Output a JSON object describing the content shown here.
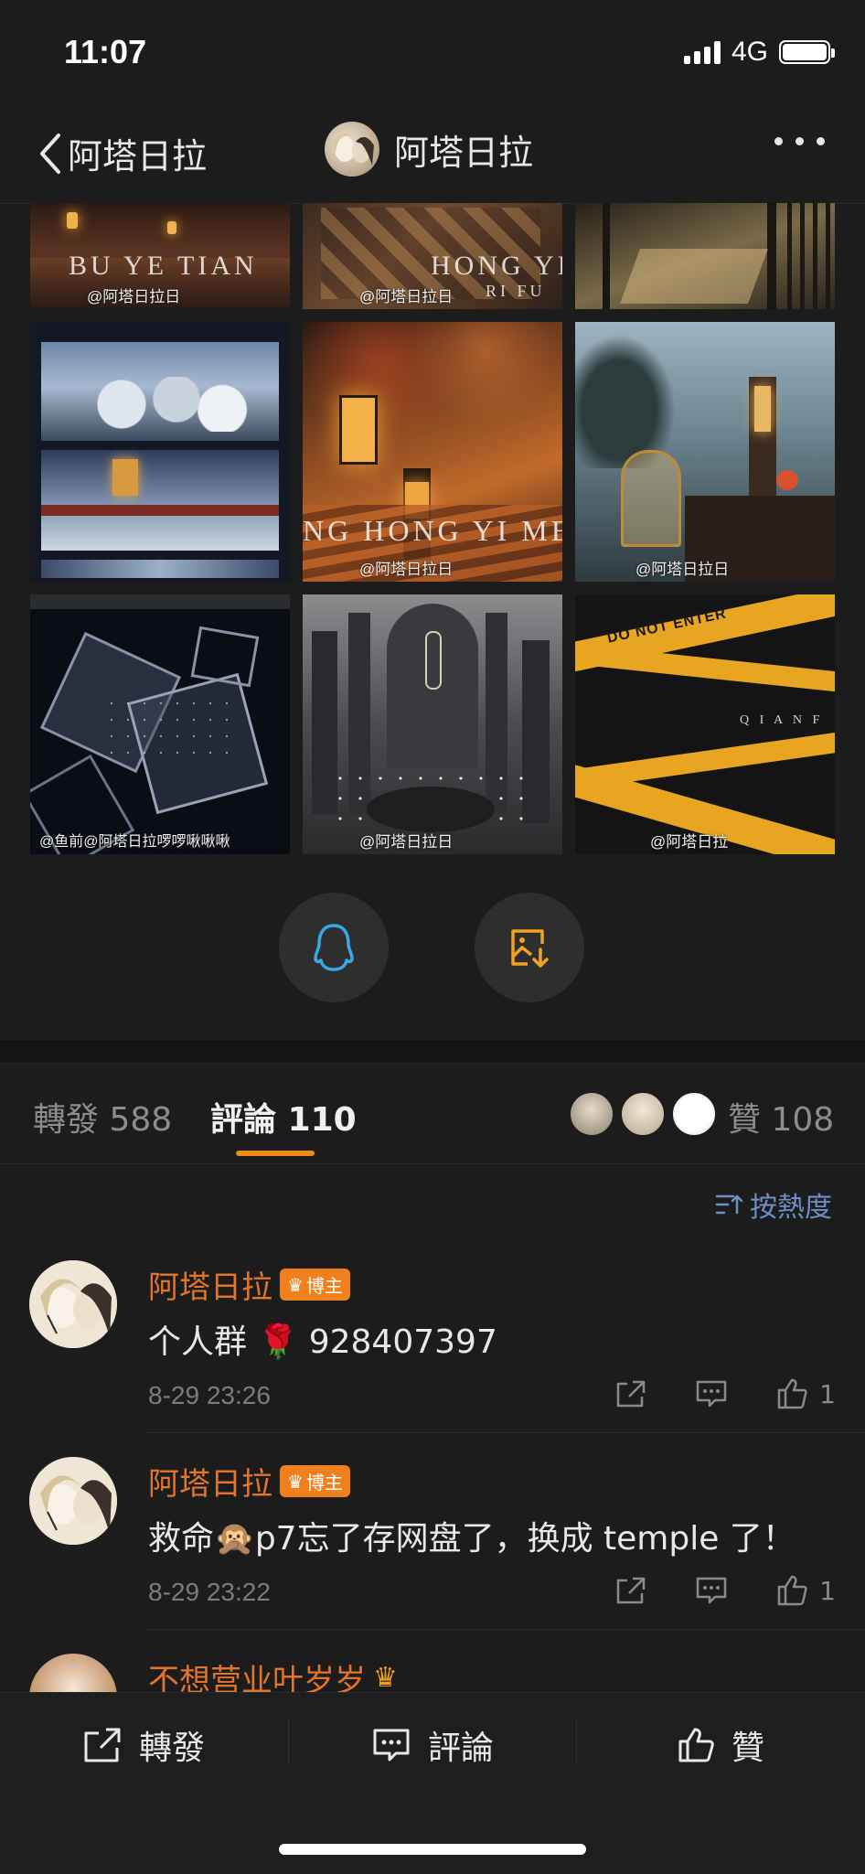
{
  "status_bar": {
    "time": "11:07",
    "network": "4G"
  },
  "nav": {
    "back_label": "阿塔日拉",
    "title": "阿塔日拉"
  },
  "gallery": {
    "images": [
      {
        "overlay_text": "BU YE TIAN",
        "watermark": "@阿塔日拉日"
      },
      {
        "overlay_text": "HONG YE",
        "overlay_text2": "RI FU",
        "watermark": "@阿塔日拉日"
      },
      {
        "overlay_text": "",
        "watermark": ""
      },
      {
        "overlay_text": "",
        "watermark": ""
      },
      {
        "overlay_text": "NG HONG YI MEN",
        "watermark": "@阿塔日拉日"
      },
      {
        "overlay_text": "",
        "watermark": "@阿塔日拉日"
      },
      {
        "overlay_text": "",
        "watermark": "@鱼前@阿塔日拉啰啰啾啾啾"
      },
      {
        "overlay_text": "",
        "watermark": "@阿塔日拉日"
      },
      {
        "overlay_text": "DO NOT ENTER",
        "overlay_text2": "Q I A N  F",
        "watermark": "@阿塔日拉"
      }
    ]
  },
  "share": {
    "qq_icon": "qq-icon",
    "save_icon": "save-image-icon"
  },
  "tabs": {
    "repost_label": "轉發",
    "repost_count": "588",
    "comment_label": "評論",
    "comment_count": "110",
    "like_label": "贊",
    "like_count": "108"
  },
  "sort_label": "按熱度",
  "comments": [
    {
      "name": "阿塔日拉",
      "badge": "博主",
      "text": "个人群 🌹 928407397",
      "time": "8-29 23:26",
      "likes": "1"
    },
    {
      "name": "阿塔日拉",
      "badge": "博主",
      "text": "救命🙊p7忘了存网盘了，换成 temple 了！",
      "time": "8-29 23:22",
      "likes": "1"
    },
    {
      "name": "不想营业叶岁岁",
      "badge": "",
      "text": "",
      "time": "",
      "likes": ""
    }
  ],
  "bottom_bar": {
    "repost": "轉發",
    "comment": "評論",
    "like": "贊"
  },
  "colors": {
    "accent": "#f08a1b",
    "name": "#e2752d",
    "link": "#6f8fc4",
    "bg": "#1c1c1d"
  }
}
